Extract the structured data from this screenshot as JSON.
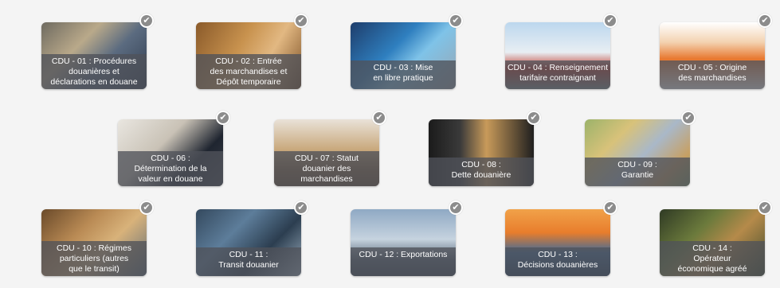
{
  "cards": [
    {
      "label": "CDU - 01 : Procédures\ndouanières et\ndéclarations en douane",
      "check": "✔"
    },
    {
      "label": "CDU - 02 : Entrée\ndes marchandises et\nDépôt temporaire",
      "check": "✔"
    },
    {
      "label": "CDU - 03 : Mise\nen libre pratique",
      "check": "✔"
    },
    {
      "label": "CDU - 04 : Renseignement\ntarifaire contraignant",
      "check": "✔"
    },
    {
      "label": "CDU - 05 : Origine\ndes marchandises",
      "check": "✔"
    },
    {
      "label": "CDU - 06 :\nDétermination de la\nvaleur en douane",
      "check": "✔"
    },
    {
      "label": "CDU - 07 : Statut\ndouanier des\nmarchandises",
      "check": "✔"
    },
    {
      "label": "CDU - 08 :\nDette douanière",
      "check": "✔"
    },
    {
      "label": "CDU - 09 :\nGarantie",
      "check": "✔"
    },
    {
      "label": "CDU - 10 : Régimes\nparticuliers (autres\nque le transit)",
      "check": "✔"
    },
    {
      "label": "CDU - 11 :\nTransit douanier",
      "check": "✔"
    },
    {
      "label": "CDU - 12 : Exportations",
      "check": "✔"
    },
    {
      "label": "CDU - 13 :\nDécisions douanières",
      "check": "✔"
    },
    {
      "label": "CDU - 14 :\nOpérateur\néconomique agréé",
      "check": "✔"
    }
  ],
  "colors": {
    "caption_bg": "#50525a",
    "check_bg": "#8c8c8c",
    "page_bg": "#f4f4f4"
  },
  "icons": {
    "completed": "checkmark-icon"
  }
}
